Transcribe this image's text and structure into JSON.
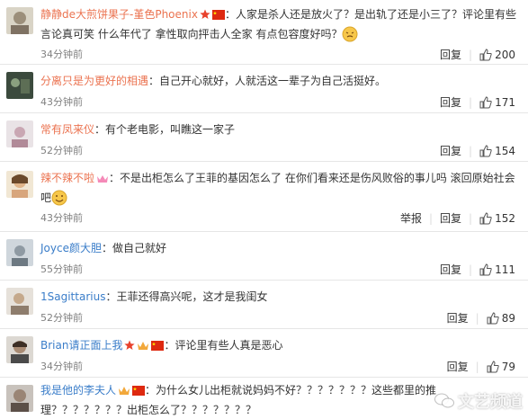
{
  "comments": [
    {
      "username": "静静de大煎饼果子-堇色Phoenix",
      "text": "：人家是杀人还是放火了？是出轨了还是小三了？评论里有些言论真可笑 什么年代了 拿性取向抨击人全家 有点包容度好吗？",
      "time": "34分钟前",
      "reply": "回复",
      "likes": "200",
      "report": ""
    },
    {
      "username": "分离只是为更好的相遇",
      "text": "：自己开心就好，人就活这一辈子为自己活挺好。",
      "time": "43分钟前",
      "reply": "回复",
      "likes": "171",
      "report": ""
    },
    {
      "username": "常有凤来仪",
      "text": "：有个老电影，叫瞧这一家子",
      "time": "52分钟前",
      "reply": "回复",
      "likes": "154",
      "report": ""
    },
    {
      "username": "辣不辣不啦",
      "text": "：不是出柜怎么了王菲的基因怎么了 在你们看来还是伤风败俗的事儿吗 滚回原始社会吧",
      "time": "43分钟前",
      "reply": "回复",
      "likes": "152",
      "report": "举报"
    },
    {
      "username": "Joyce颜大胆",
      "text": "：做自己就好",
      "time": "55分钟前",
      "reply": "回复",
      "likes": "111",
      "report": ""
    },
    {
      "username": "1Sagittarius",
      "text": "：王菲还得高兴呢，这才是我闺女",
      "time": "52分钟前",
      "reply": "回复",
      "likes": "89",
      "report": ""
    },
    {
      "username": "Brian请正面上我",
      "text": "：评论里有些人真是恶心",
      "time": "34分钟前",
      "reply": "回复",
      "likes": "79",
      "report": ""
    },
    {
      "username": "我是他的李夫人",
      "text": "：为什么女儿出柜就说妈妈不好？？？？？？？这些都里的推理？？？？？？？出柜怎么了？？？？？？？",
      "time": "",
      "reply": "",
      "likes": "",
      "report": ""
    }
  ],
  "watermark": "文艺频道",
  "colors": {
    "username": "#eb7350",
    "time": "#808080",
    "divider": "#e6e6e6"
  }
}
